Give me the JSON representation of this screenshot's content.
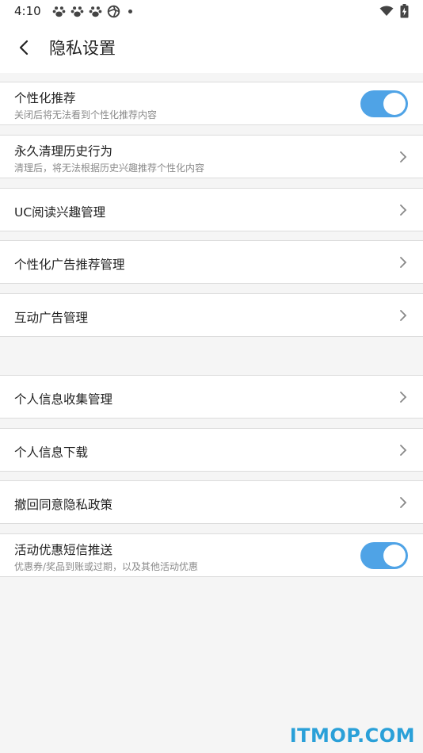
{
  "status_bar": {
    "time": "4:10",
    "left_icons": [
      "paw-icon",
      "paw-icon",
      "paw-icon",
      "aperture-icon",
      "dot-icon"
    ],
    "right_icons": [
      "wifi-icon",
      "battery-charging-icon"
    ]
  },
  "header": {
    "back_icon": "chevron-left-icon",
    "title": "隐私设置"
  },
  "settings": [
    {
      "id": "personalized-recommend",
      "title": "个性化推荐",
      "subtitle": "关闭后将无法看到个性化推荐内容",
      "control": "toggle",
      "enabled": true
    },
    {
      "id": "clear-history",
      "title": "永久清理历史行为",
      "subtitle": "清理后，将无法根据历史兴趣推荐个性化内容",
      "control": "chevron"
    },
    {
      "id": "uc-reading-interest",
      "title": "UC阅读兴趣管理",
      "control": "chevron"
    },
    {
      "id": "personalized-ad",
      "title": "个性化广告推荐管理",
      "control": "chevron"
    },
    {
      "id": "interactive-ad",
      "title": "互动广告管理",
      "control": "chevron"
    },
    {
      "id": "personal-info-collect",
      "title": "个人信息收集管理",
      "control": "chevron"
    },
    {
      "id": "personal-info-download",
      "title": "个人信息下载",
      "control": "chevron"
    },
    {
      "id": "revoke-privacy",
      "title": "撤回同意隐私政策",
      "control": "chevron"
    },
    {
      "id": "promo-sms",
      "title": "活动优惠短信推送",
      "subtitle": "优惠券/奖品到账或过期，以及其他活动优惠",
      "control": "toggle",
      "enabled": true
    }
  ],
  "watermark": "ITMOP.COM",
  "colors": {
    "toggle_on": "#4fa3e6",
    "background": "#f5f5f5",
    "watermark": "#2aa0d8"
  }
}
